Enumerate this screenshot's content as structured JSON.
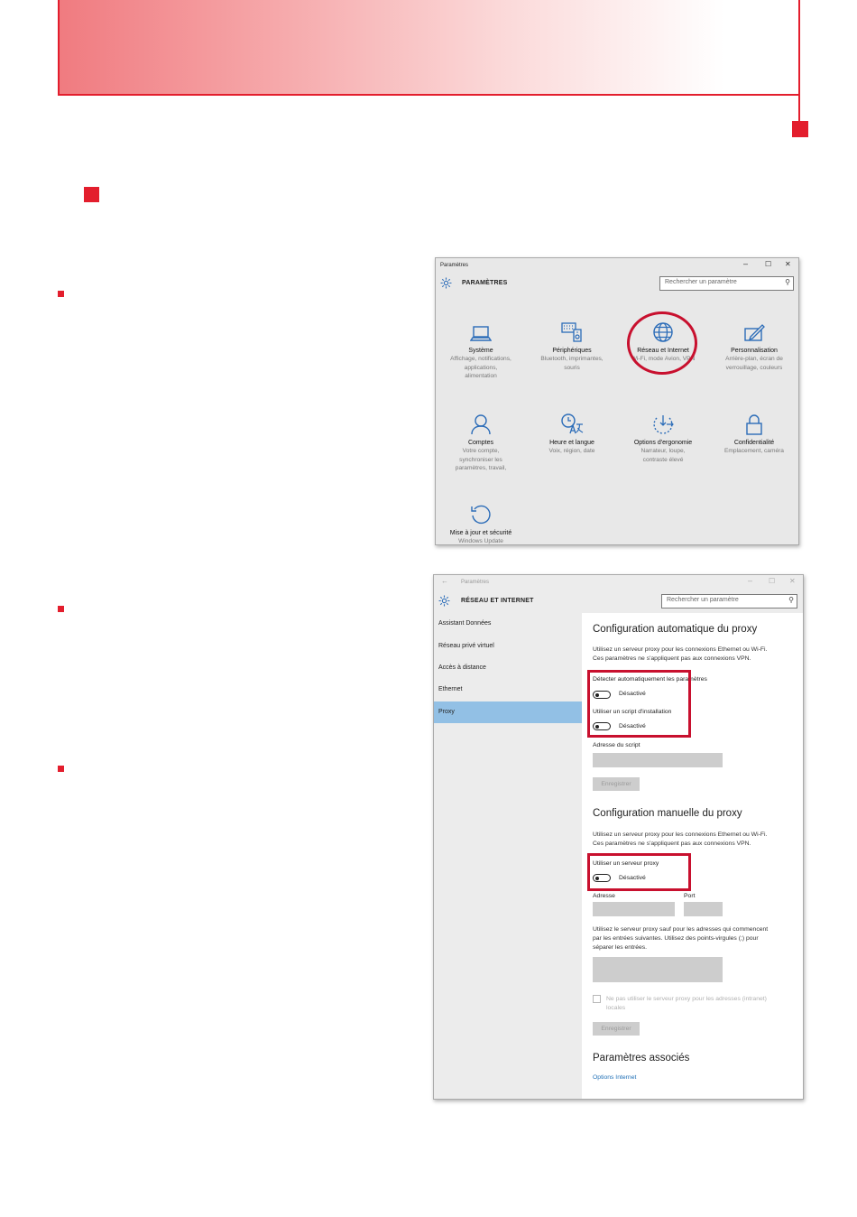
{
  "window_settings": {
    "title": "Paramètres",
    "heading": "PARAMÈTRES",
    "search_placeholder": "Rechercher un paramètre",
    "controls": {
      "minimize": "–",
      "maximize": "☐",
      "close": "✕"
    },
    "tiles": [
      {
        "icon": "laptop-icon",
        "title": "Système",
        "subtitle": [
          "Affichage, notifications,",
          "applications,",
          "alimentation"
        ]
      },
      {
        "icon": "keyboard-speaker-icon",
        "title": "Périphériques",
        "subtitle": [
          "Bluetooth, imprimantes,",
          "souris"
        ]
      },
      {
        "icon": "globe-icon",
        "title": "Réseau et Internet",
        "subtitle": [
          "Wi-Fi, mode Avion, VPN"
        ]
      },
      {
        "icon": "paint-brush-icon",
        "title": "Personnalisation",
        "subtitle": [
          "Arrière-plan, écran de",
          "verrouillage, couleurs"
        ]
      },
      {
        "icon": "person-icon",
        "title": "Comptes",
        "subtitle": [
          "Votre compte,",
          "synchroniser les",
          "paramètres, travail,"
        ]
      },
      {
        "icon": "time-language-icon",
        "title": "Heure et langue",
        "subtitle": [
          "Voix, région, date"
        ]
      },
      {
        "icon": "ease-of-access-icon",
        "title": "Options d'ergonomie",
        "subtitle": [
          "Narrateur, loupe,",
          "contraste élevé"
        ]
      },
      {
        "icon": "lock-icon",
        "title": "Confidentialité",
        "subtitle": [
          "Emplacement, caméra"
        ]
      },
      {
        "icon": "update-icon",
        "title": "Mise à jour et sécurité",
        "subtitle": [
          "Windows Update"
        ]
      }
    ]
  },
  "window_network": {
    "title": "Paramètres",
    "heading": "RÉSEAU ET INTERNET",
    "search_placeholder": "Rechercher un paramètre",
    "controls": {
      "back": "←",
      "minimize": "–",
      "maximize": "☐",
      "close": "✕"
    },
    "nav": [
      "Assistant Données",
      "Réseau privé virtuel",
      "Accès à distance",
      "Ethernet",
      "Proxy"
    ],
    "active_nav": "Proxy",
    "auto": {
      "heading": "Configuration automatique du proxy",
      "desc": [
        "Utilisez un serveur proxy pour les connexions Ethernet ou Wi-Fi.",
        "Ces paramètres ne s'appliquent pas aux connexions VPN."
      ],
      "detect_label": "Détecter automatiquement les paramètres",
      "detect_state": "Désactivé",
      "script_label": "Utiliser un script d'installation",
      "script_state": "Désactivé",
      "script_address_label": "Adresse du script",
      "save_label": "Enregistrer"
    },
    "manual": {
      "heading": "Configuration manuelle du proxy",
      "desc": [
        "Utilisez un serveur proxy pour les connexions Ethernet ou Wi-Fi.",
        "Ces paramètres ne s'appliquent pas aux connexions VPN."
      ],
      "proxy_label": "Utiliser un serveur proxy",
      "proxy_state": "Désactivé",
      "address_label": "Adresse",
      "port_label": "Port",
      "exceptions_desc": [
        "Utilisez le serveur proxy sauf pour les adresses qui commencent",
        "par les entrées suivantes. Utilisez des points-virgules (;) pour",
        "séparer les entrées."
      ],
      "local_checkbox": [
        "Ne pas utiliser le serveur proxy pour les adresses (intranet)",
        "locales"
      ],
      "save_label": "Enregistrer"
    },
    "related": {
      "heading": "Paramètres associés",
      "link": "Options Internet"
    }
  },
  "colors": {
    "accent_red": "#e31e2d",
    "highlight_red": "#c8102e",
    "icon_blue": "#2b6cb8",
    "selected_nav": "#92c0e5"
  }
}
